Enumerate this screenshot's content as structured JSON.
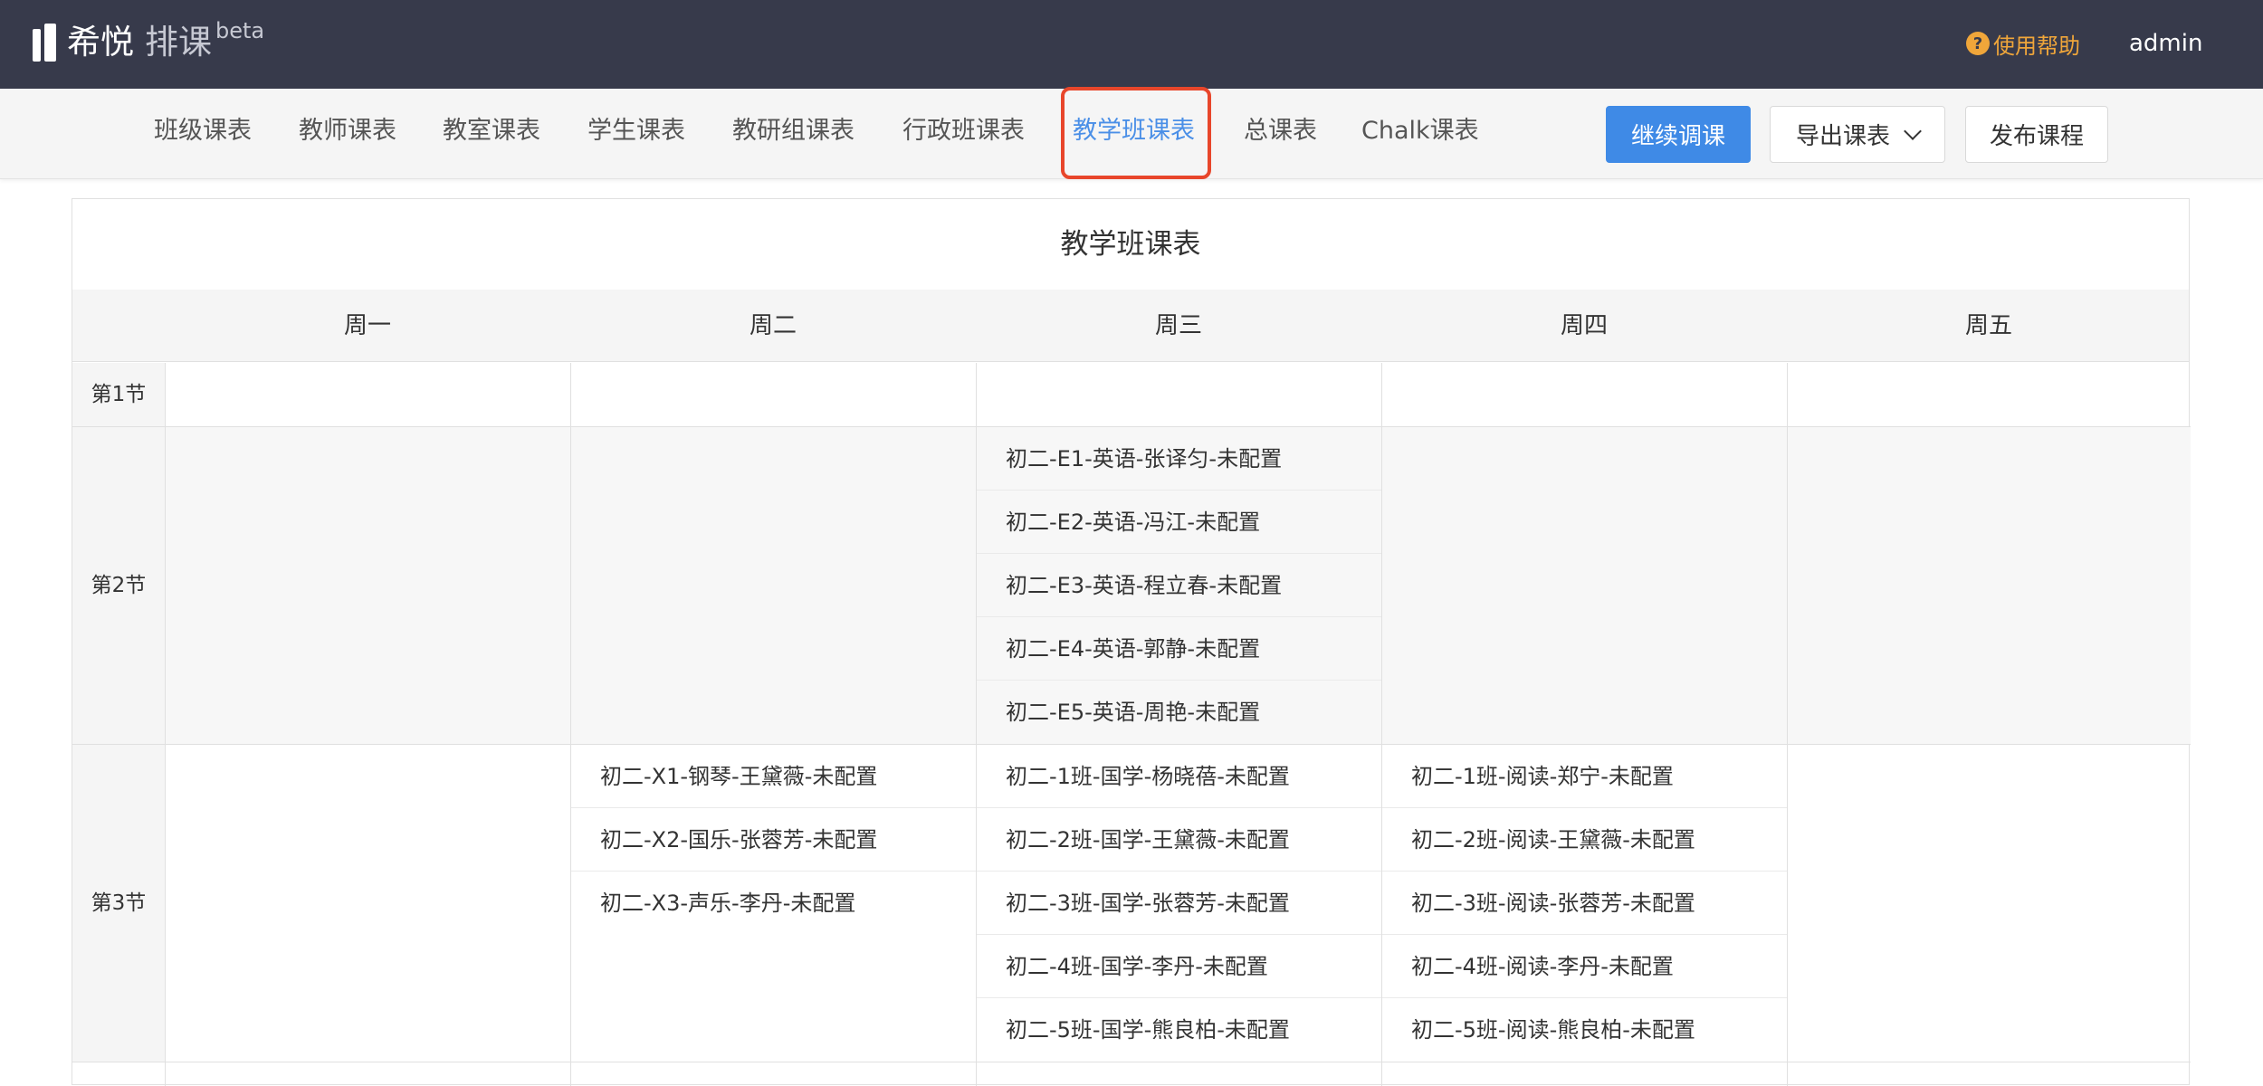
{
  "header": {
    "brand": "希悦",
    "product": "排课",
    "badge": "beta",
    "help_label": "使用帮助",
    "help_icon": "question-circle-icon",
    "user": "admin",
    "colors": {
      "bar": "#373a4b",
      "help": "#f0a63a"
    }
  },
  "tabs": [
    {
      "label": "班级课表",
      "active": false
    },
    {
      "label": "教师课表",
      "active": false
    },
    {
      "label": "教室课表",
      "active": false
    },
    {
      "label": "学生课表",
      "active": false
    },
    {
      "label": "教研组课表",
      "active": false
    },
    {
      "label": "行政班课表",
      "active": false
    },
    {
      "label": "教学班课表",
      "active": true
    },
    {
      "label": "总课表",
      "active": false
    },
    {
      "label": "Chalk课表",
      "active": false
    }
  ],
  "actions": {
    "continue": "继续调课",
    "export": "导出课表",
    "publish": "发布课程"
  },
  "timetable": {
    "title": "教学班课表",
    "days": [
      "周一",
      "周二",
      "周三",
      "周四",
      "周五"
    ],
    "periods": [
      {
        "label": "第1节",
        "cells": [
          [],
          [],
          [],
          [],
          []
        ]
      },
      {
        "label": "第2节",
        "cells": [
          [],
          [],
          [
            "初二-E1-英语-张译匀-未配置",
            "初二-E2-英语-冯江-未配置",
            "初二-E3-英语-程立春-未配置",
            "初二-E4-英语-郭静-未配置",
            "初二-E5-英语-周艳-未配置"
          ],
          [],
          []
        ]
      },
      {
        "label": "第3节",
        "cells": [
          [],
          [
            "初二-X1-钢琴-王黛薇-未配置",
            "初二-X2-国乐-张蓉芳-未配置",
            "初二-X3-声乐-李丹-未配置"
          ],
          [
            "初二-1班-国学-杨晓蓓-未配置",
            "初二-2班-国学-王黛薇-未配置",
            "初二-3班-国学-张蓉芳-未配置",
            "初二-4班-国学-李丹-未配置",
            "初二-5班-国学-熊良柏-未配置"
          ],
          [
            "初二-1班-阅读-郑宁-未配置",
            "初二-2班-阅读-王黛薇-未配置",
            "初二-3班-阅读-张蓉芳-未配置",
            "初二-4班-阅读-李丹-未配置",
            "初二-5班-阅读-熊良柏-未配置"
          ],
          []
        ]
      }
    ]
  }
}
